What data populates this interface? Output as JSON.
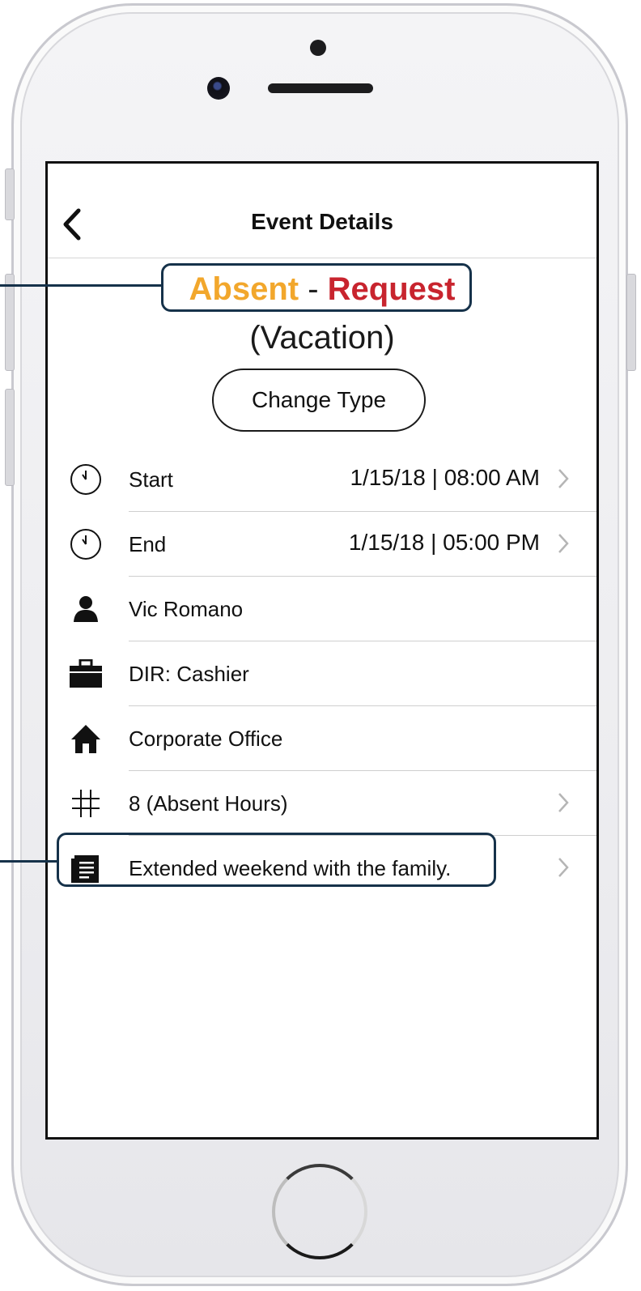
{
  "navbar": {
    "title": "Event Details",
    "back_icon": "chevron-left-icon"
  },
  "event": {
    "type_primary": "Absent",
    "type_separator": "-",
    "type_status": "Request",
    "subtype": "(Vacation)",
    "change_type_label": "Change Type"
  },
  "rows": {
    "start": {
      "icon": "clock-icon",
      "label": "Start",
      "value": "1/15/18 | 08:00 AM"
    },
    "end": {
      "icon": "clock-icon",
      "label": "End",
      "value": "1/15/18 | 05:00 PM"
    },
    "employee": {
      "icon": "person-icon",
      "label": "Vic Romano"
    },
    "position": {
      "icon": "briefcase-icon",
      "label": "DIR: Cashier"
    },
    "location": {
      "icon": "home-icon",
      "label": "Corporate Office"
    },
    "hours": {
      "icon": "hash-icon",
      "label": "8 (Absent Hours)"
    },
    "note": {
      "icon": "document-icon",
      "label": "Extended weekend with the family."
    }
  },
  "colors": {
    "absent": "#f2a72c",
    "request": "#c8242e",
    "callout": "#16324a"
  }
}
